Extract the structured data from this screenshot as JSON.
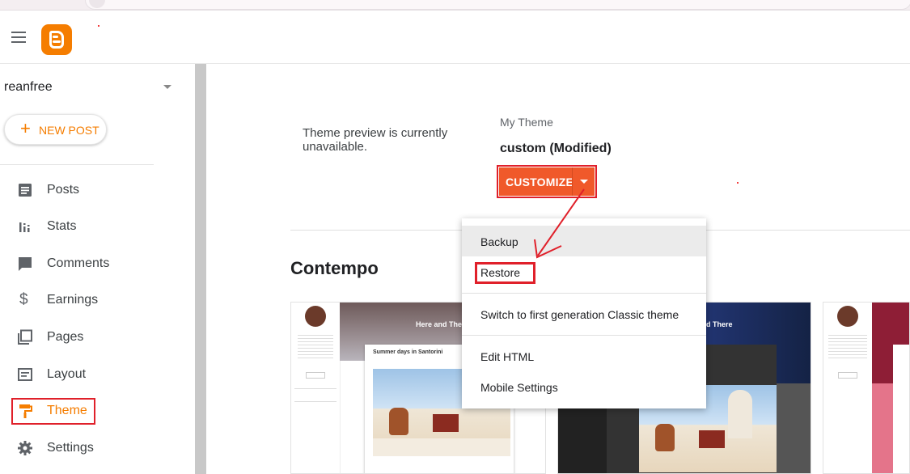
{
  "header": {
    "menu_icon": "hamburger-icon",
    "logo_icon": "blogger-logo"
  },
  "sidebar": {
    "blog_name": "reanfree",
    "new_post": {
      "icon": "plus-icon",
      "label": "NEW POST"
    },
    "items": [
      {
        "label": "Posts",
        "icon": "posts-icon"
      },
      {
        "label": "Stats",
        "icon": "stats-icon"
      },
      {
        "label": "Comments",
        "icon": "comments-icon"
      },
      {
        "label": "Earnings",
        "icon": "dollar-icon"
      },
      {
        "label": "Pages",
        "icon": "pages-icon"
      },
      {
        "label": "Layout",
        "icon": "layout-icon"
      },
      {
        "label": "Theme",
        "icon": "paint-roller-icon",
        "active": true
      },
      {
        "label": "Settings",
        "icon": "gear-icon"
      }
    ]
  },
  "main": {
    "preview_unavailable": "Theme preview is currently unavailable.",
    "my_theme_label": "My Theme",
    "theme_name": "custom (Modified)",
    "customize_label": "CUSTOMIZE",
    "section_title": "Contempo",
    "cards": [
      {
        "header": "Here and There",
        "post_title": "Summer days in Santorini"
      },
      {
        "header": "Here and There"
      },
      {
        "header": ""
      }
    ]
  },
  "dropdown": {
    "items": [
      "Backup",
      "Restore",
      "Switch to first generation Classic theme",
      "Edit HTML",
      "Mobile Settings"
    ]
  },
  "colors": {
    "accent": "#f57d00",
    "customize": "#f0592a",
    "annotation": "#e0202a"
  }
}
